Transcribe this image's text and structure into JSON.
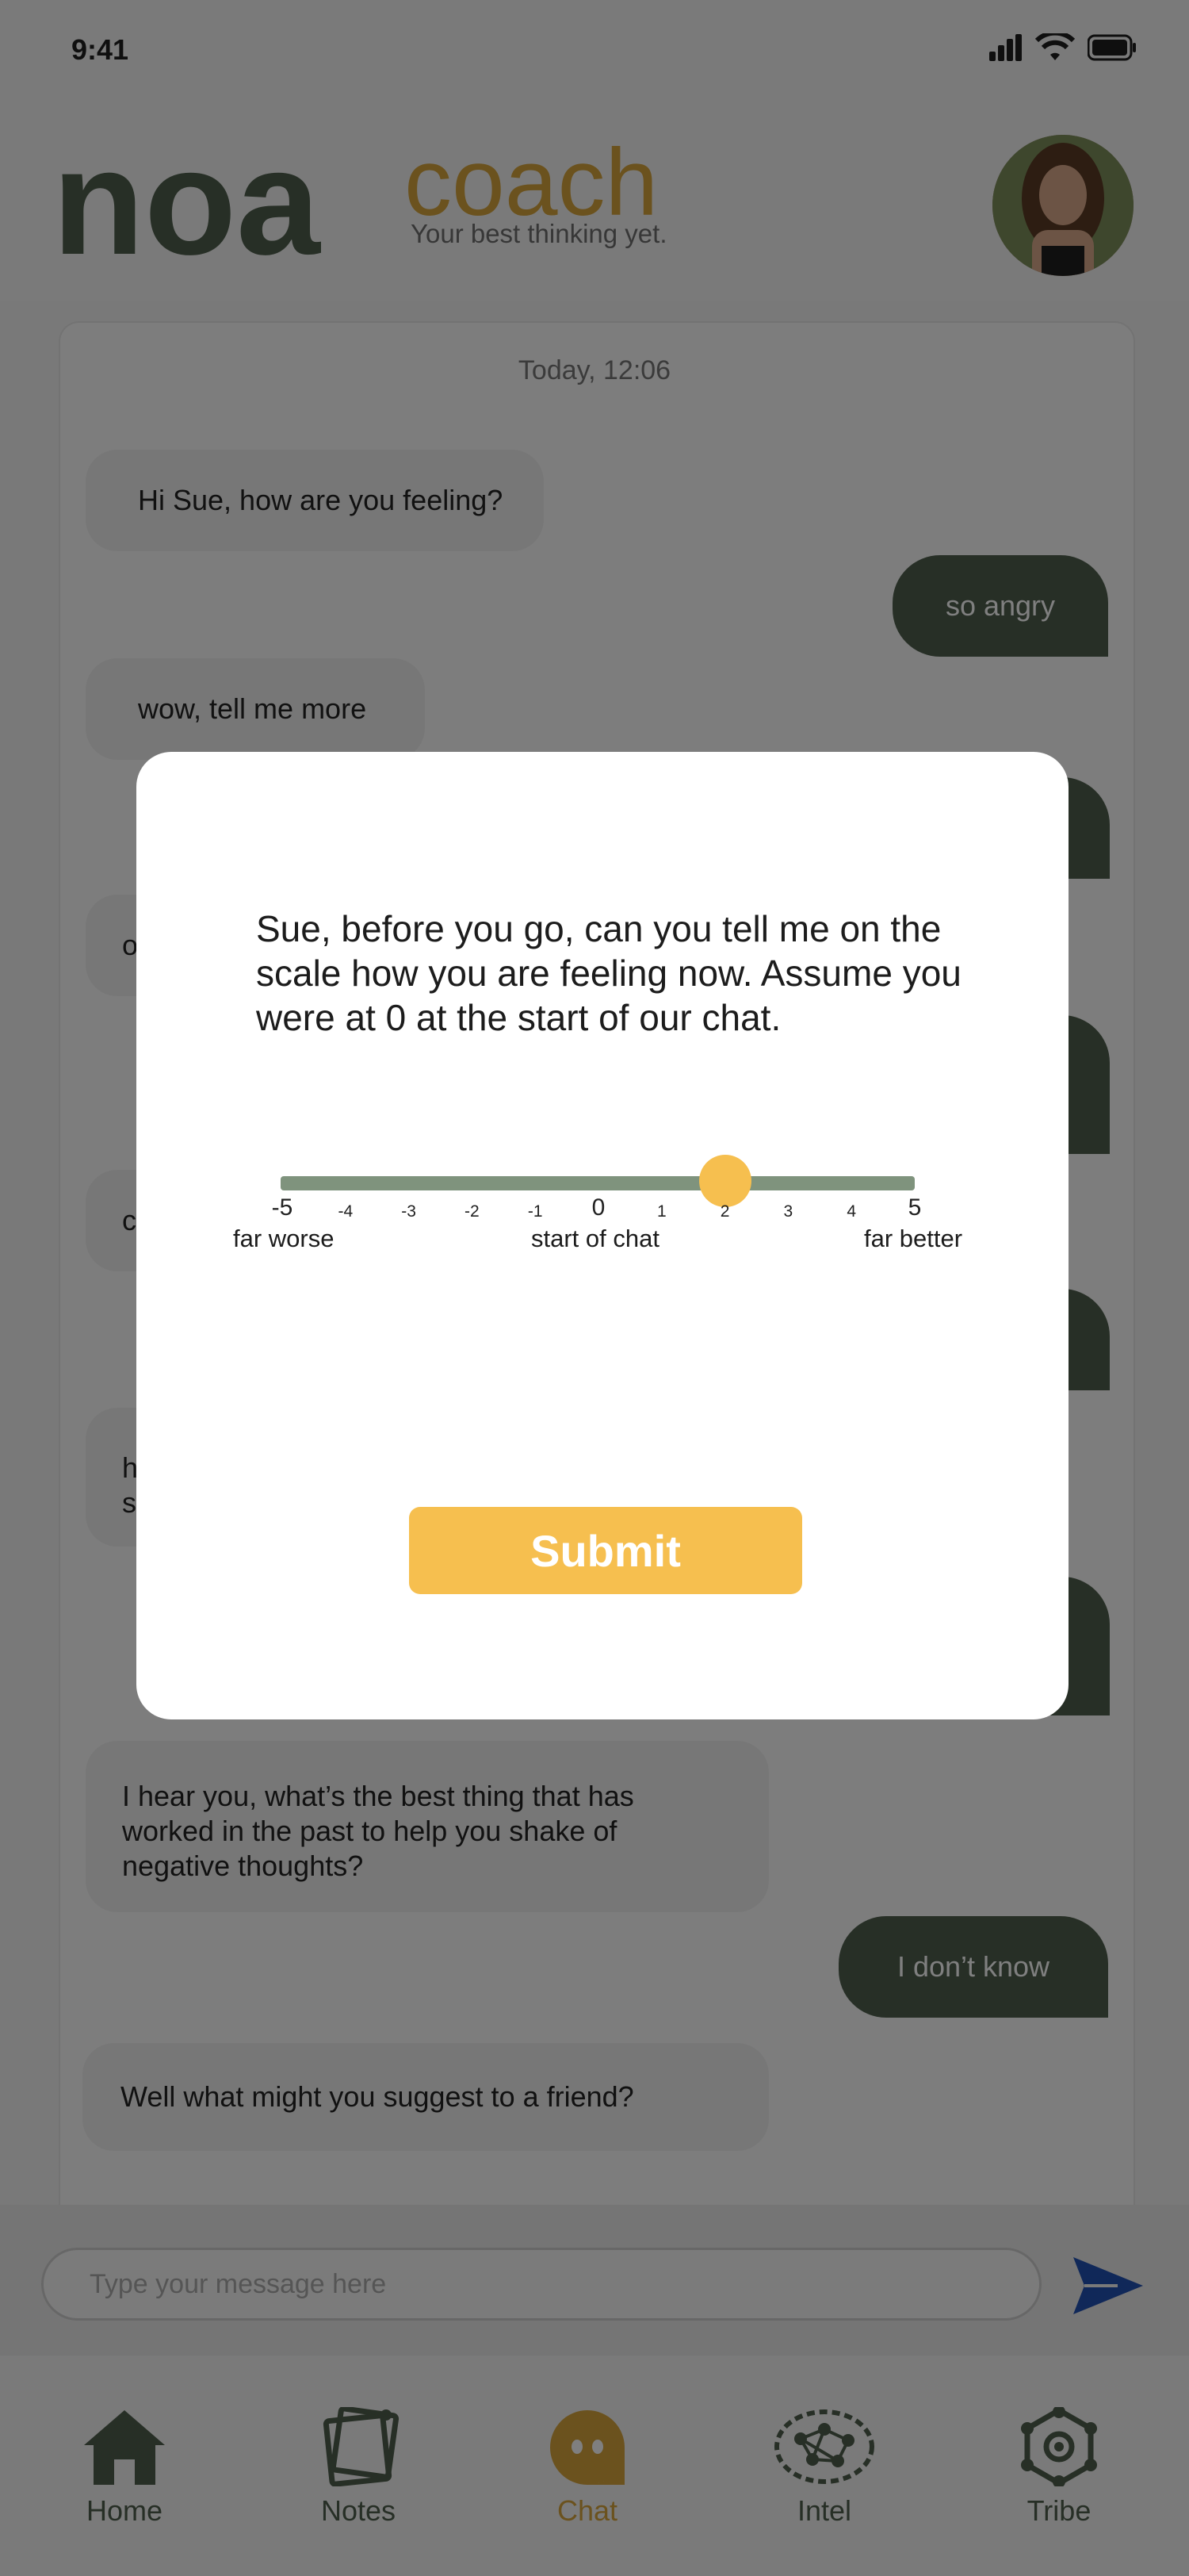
{
  "status": {
    "time": "9:41"
  },
  "brand": {
    "name_part1": "noa",
    "name_part2": "coach",
    "tagline": "Your best thinking yet."
  },
  "chat": {
    "timestamp": "Today, 12:06",
    "messages": [
      {
        "from": "coach",
        "text": "Hi Sue, how are you feeling?"
      },
      {
        "from": "user",
        "text": "so angry"
      },
      {
        "from": "coach",
        "text": "wow, tell me more"
      },
      {
        "from": "coach",
        "text": "o"
      },
      {
        "from": "coach",
        "text": "c"
      },
      {
        "from": "coach",
        "text": "h\ns"
      },
      {
        "from": "coach",
        "text": "I hear you, what’s the best thing that has worked in the past to help you shake of negative thoughts?"
      },
      {
        "from": "user",
        "text": "I don’t know"
      },
      {
        "from": "coach",
        "text": "Well what might you suggest to a friend?"
      }
    ]
  },
  "input": {
    "placeholder": "Type your message here"
  },
  "tabs": [
    {
      "label": "Home",
      "icon": "home-icon",
      "active": false
    },
    {
      "label": "Notes",
      "icon": "notes-icon",
      "active": false
    },
    {
      "label": "Chat",
      "icon": "chat-icon",
      "active": true
    },
    {
      "label": "Intel",
      "icon": "brain-icon",
      "active": false
    },
    {
      "label": "Tribe",
      "icon": "network-icon",
      "active": false
    }
  ],
  "modal": {
    "question": "Sue, before you go, can you tell me on the scale how you are feeling now. Assume you were at 0 at the start of our chat.",
    "scale_ticks": [
      "-5",
      "-4",
      "-3",
      "-2",
      "-1",
      "0",
      "1",
      "2",
      "3",
      "4",
      "5"
    ],
    "scale_min_label": "far worse",
    "scale_mid_label": "start of chat",
    "scale_max_label": "far better",
    "slider_value": 2,
    "submit_label": "Submit"
  },
  "colors": {
    "primary": "#4f5f4d",
    "accent": "#f6bf4f",
    "send": "#2150b3"
  }
}
